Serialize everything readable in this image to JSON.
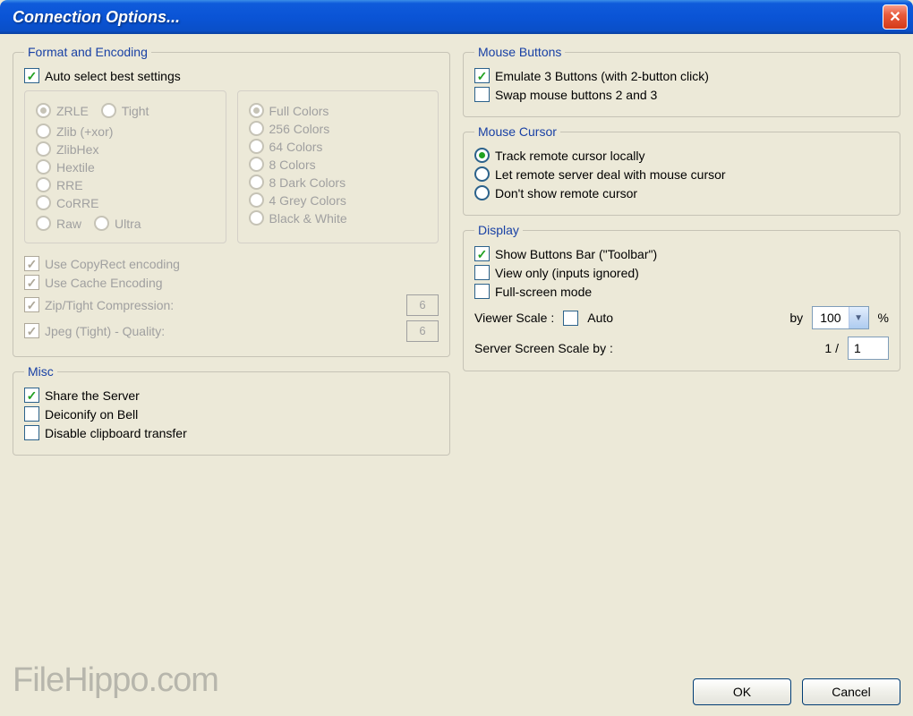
{
  "window": {
    "title": "Connection Options..."
  },
  "format": {
    "legend": "Format and Encoding",
    "auto_select": "Auto select best settings",
    "enc": {
      "zrle": "ZRLE",
      "tight": "Tight",
      "zlib": "Zlib (+xor)",
      "zlibhex": "ZlibHex",
      "hextile": "Hextile",
      "rre": "RRE",
      "corre": "CoRRE",
      "raw": "Raw",
      "ultra": "Ultra"
    },
    "colors": {
      "full": "Full Colors",
      "c256": "256 Colors",
      "c64": "64 Colors",
      "c8": "8 Colors",
      "dark8": "8 Dark Colors",
      "grey4": "4 Grey Colors",
      "bw": "Black & White"
    },
    "copyrect": "Use CopyRect encoding",
    "cache": "Use Cache Encoding",
    "zip": "Zip/Tight Compression:",
    "zip_val": "6",
    "jpeg": "Jpeg (Tight) - Quality:",
    "jpeg_val": "6"
  },
  "misc": {
    "legend": "Misc",
    "share": "Share the Server",
    "deiconify": "Deiconify on Bell",
    "clipboard": "Disable clipboard transfer"
  },
  "mouse_buttons": {
    "legend": "Mouse Buttons",
    "emulate": "Emulate 3 Buttons (with 2-button click)",
    "swap": "Swap mouse buttons 2 and 3"
  },
  "mouse_cursor": {
    "legend": "Mouse Cursor",
    "track": "Track remote cursor locally",
    "remote": "Let remote server deal with mouse cursor",
    "hide": "Don't show remote cursor"
  },
  "display": {
    "legend": "Display",
    "toolbar": "Show Buttons Bar (\"Toolbar\")",
    "viewonly": "View only (inputs ignored)",
    "fullscreen": "Full-screen mode",
    "viewer_scale": "Viewer Scale :",
    "auto": "Auto",
    "by": "by",
    "scale_val": "100",
    "percent": "%",
    "server_scale": "Server Screen Scale by :",
    "server_num": "1  /",
    "server_val": "1"
  },
  "buttons": {
    "ok": "OK",
    "cancel": "Cancel"
  },
  "watermark": "FileHippo.com"
}
